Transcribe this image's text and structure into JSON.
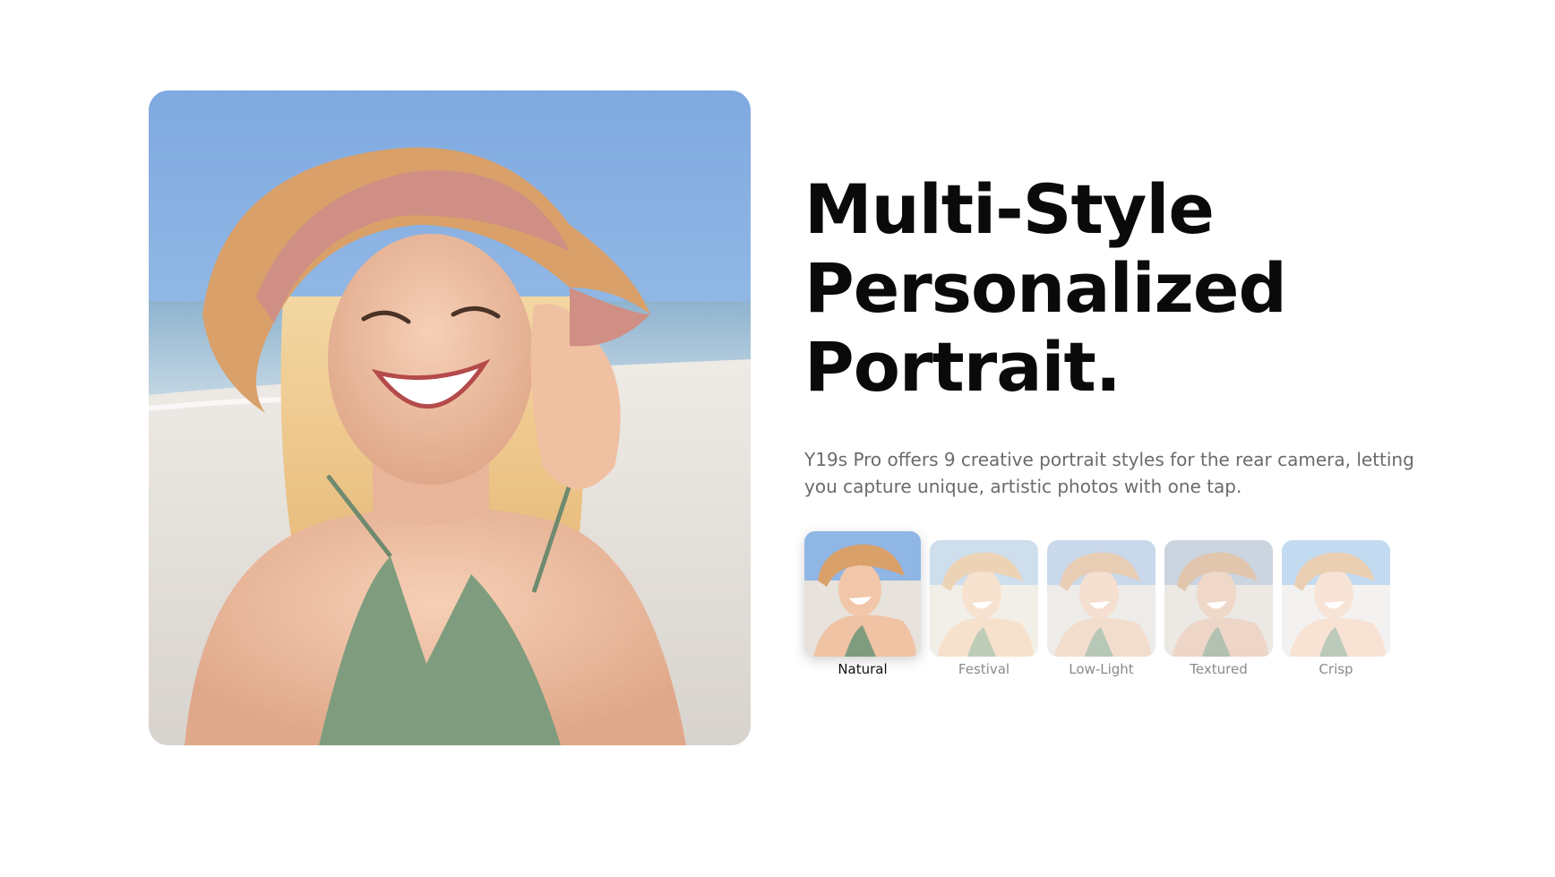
{
  "hero": {
    "image_icon": "smiling-woman-beach-portrait"
  },
  "headline": {
    "line1": "Multi-Style",
    "line2": "Personalized",
    "line3": "Portrait."
  },
  "description": "Y19s Pro offers 9 creative portrait styles for the rear camera, letting you capture unique, artistic photos with one tap.",
  "styles": [
    {
      "label": "Natural",
      "selected": true
    },
    {
      "label": "Festival",
      "selected": false
    },
    {
      "label": "Low-Light",
      "selected": false
    },
    {
      "label": "Textured",
      "selected": false
    },
    {
      "label": "Crisp",
      "selected": false
    }
  ],
  "colors": {
    "headline": "#0a0a0a",
    "body_text": "#6b6b6b",
    "inactive_label": "#8a8a8a",
    "active_label": "#111111",
    "sky": "#86b4e4",
    "sand": "#e6e2dc",
    "swimsuit": "#7f9c7e",
    "hat": "#d9a06a"
  }
}
